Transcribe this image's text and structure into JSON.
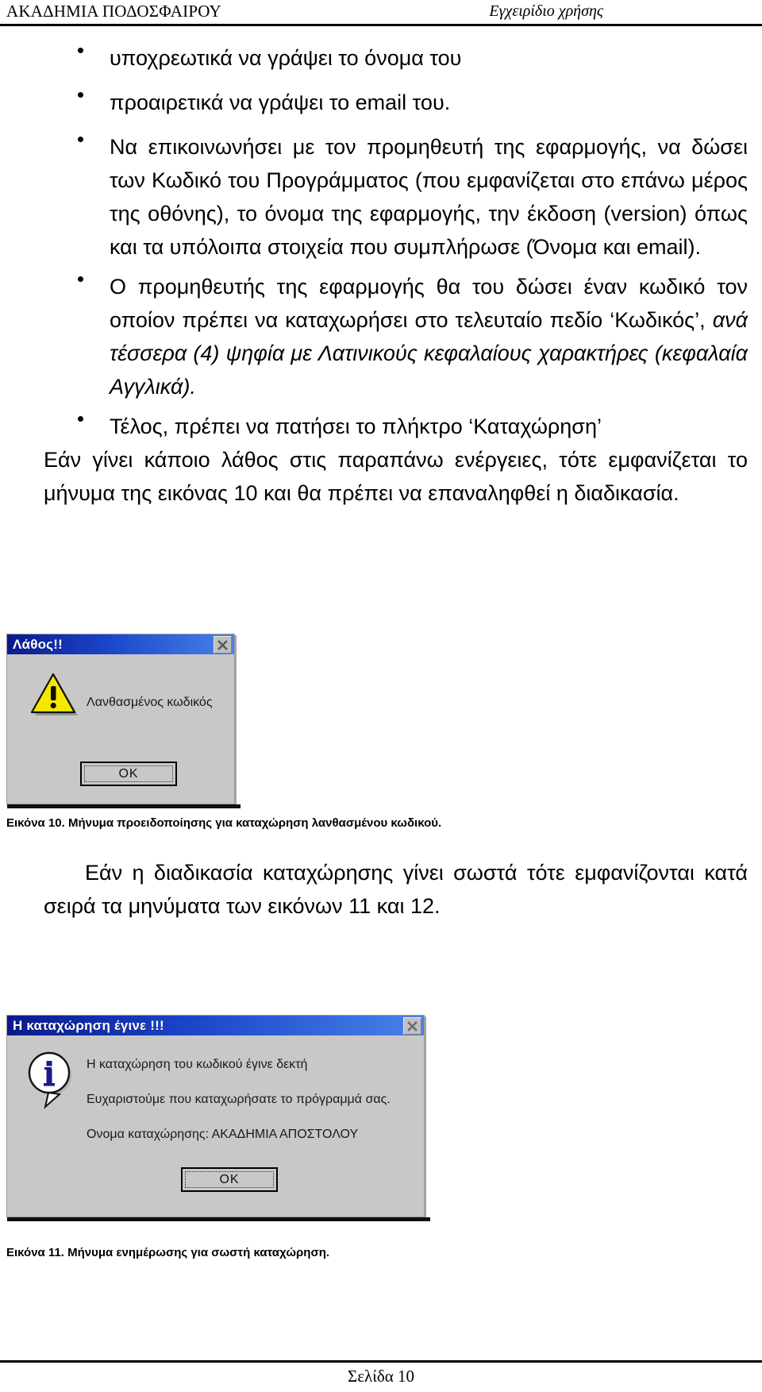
{
  "header": {
    "left_title": "ΑΚΑΔΗΜΙΑ ΠΟΔΟΣΦΑΙΡΟΥ",
    "right_title": "Εγχειρίδιο χρήσης"
  },
  "content": {
    "bullets": [
      {
        "text": "υποχρεωτικά να γράψει το όνομα του"
      },
      {
        "text": "προαιρετικά να γράψει το email του."
      },
      {
        "text": "Να επικοινωνήσει με τον προμηθευτή της εφαρμογής, να δώσει των Κωδικό του Προγράμματος (που εμφανίζεται στο επάνω μέρος της οθόνης), το όνομα της εφαρμογής, την έκδοση (version) όπως και τα υπόλοιπα στοιχεία που συμπλήρωσε (Όνομα και email)."
      },
      {
        "text_normal": "Ο προμηθευτής της εφαρμογής θα του δώσει έναν κωδικό τον οποίον πρέπει να καταχωρήσει στο τελευταίο πεδίο ‘Κωδικός’, ",
        "text_italic": "ανά τέσσερα (4) ψηφία με Λατινικούς κεφαλαίους χαρακτήρες (κεφαλαία Αγγλικά)."
      },
      {
        "text": "Τέλος, πρέπει να πατήσει το πλήκτρο ‘Καταχώρηση’"
      }
    ],
    "paragraph_error_intro": "Εάν γίνει κάποιο λάθος στις παραπάνω ενέργειες, τότε εμφανίζεται το μήνυμα της εικόνας 10 και θα πρέπει να επαναληφθεί η διαδικασία.",
    "paragraph_success_intro": "Εάν η διαδικασία καταχώρησης γίνει σωστά τότε εμφανίζονται κατά σειρά τα μηνύματα των εικόνων 11 και 12."
  },
  "figures": {
    "error_dialog": {
      "title": "Λάθος!!",
      "message": "Λανθασμένος κωδικός",
      "ok_label": "OK",
      "close_label": "✕",
      "caption": "Εικόνα 10. Μήνυμα προειδοποίησης  για καταχώρηση λανθασμένου κωδικού."
    },
    "info_dialog": {
      "title": "Η καταχώρηση έγινε !!!",
      "message_line1": "Η καταχώρηση του κωδικού έγινε δεκτή",
      "message_line2": "Ευχαριστούμε που καταχωρήσατε το πρόγραμμά σας.",
      "message_line3": "Ονομα καταχώρησης: ΑΚΑΔΗΜΙΑ ΑΠΟΣΤΟΛΟΥ",
      "ok_label": "OK",
      "close_label": "✕",
      "caption": "Εικόνα 11. Μήνυμα ενημέρωσης για σωστή καταχώρηση."
    }
  },
  "footer": {
    "page_label": "Σελίδα 10"
  },
  "colors": {
    "titlebar_start": "#0a1a8c",
    "titlebar_end": "#4a82e8",
    "dialog_face": "#c8c8c8",
    "warning_yellow": "#f5e800",
    "info_blue": "#1a1a8c"
  }
}
